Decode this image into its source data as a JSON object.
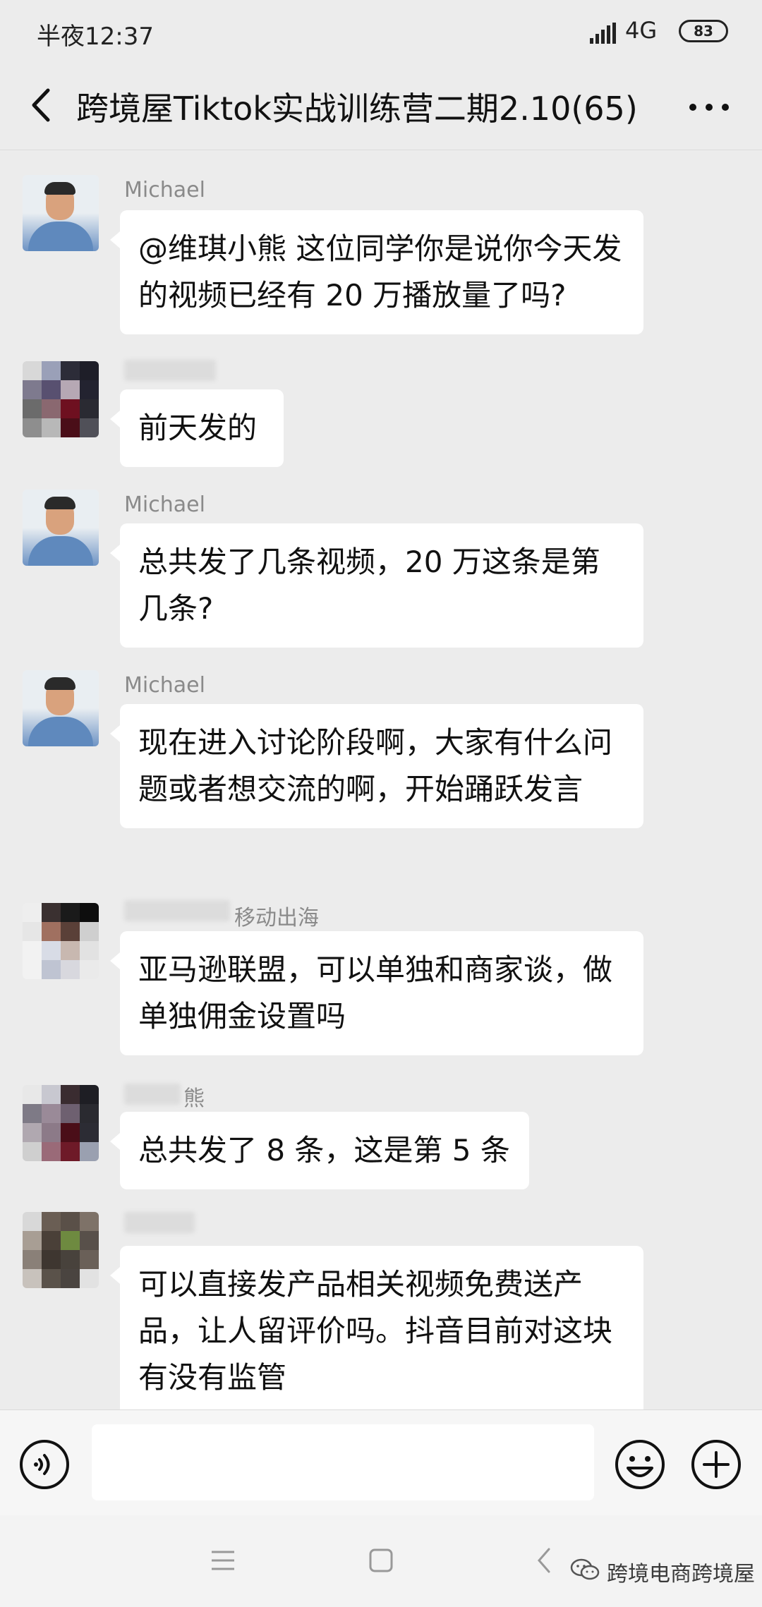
{
  "status_bar": {
    "time": "半夜12:37",
    "network": "4G",
    "battery": "83"
  },
  "header": {
    "title": "跨境屋Tiktok实战训练营二期2.10(65)"
  },
  "messages": [
    {
      "name": "Michael",
      "text": "@维琪小熊  这位同学你是说你今天发的视频已经有 20 万播放量了吗?"
    },
    {
      "name": "",
      "text": "前天发的"
    },
    {
      "name": "Michael",
      "text": "总共发了几条视频，20 万这条是第几条?"
    },
    {
      "name": "Michael",
      "text": "现在进入讨论阶段啊，大家有什么问题或者想交流的啊，开始踊跃发言"
    },
    {
      "name": "移动出海",
      "text": "亚马逊联盟，可以单独和商家谈，做单独佣金设置吗"
    },
    {
      "name": "熊",
      "text": "总共发了 8 条，这是第 5 条"
    },
    {
      "name": "",
      "text": "可以直接发产品相关视频免费送产品，让人留评价吗。抖音目前对这块有没有监管"
    }
  ],
  "watermark": {
    "text": "跨境电商跨境屋"
  }
}
